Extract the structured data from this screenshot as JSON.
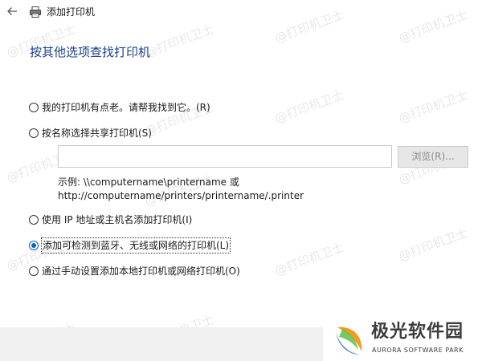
{
  "window": {
    "title": "添加打印机",
    "back_icon": "back-arrow-icon",
    "app_icon": "printer-icon"
  },
  "heading": "按其他选项查找打印机",
  "options": [
    {
      "label": "我的打印机有点老。请帮我找到它。(R)",
      "checked": false
    },
    {
      "label": "按名称选择共享打印机(S)",
      "checked": false
    },
    {
      "label": "使用 IP 地址或主机名添加打印机(I)",
      "checked": false
    },
    {
      "label": "添加可检测到蓝牙、无线或网络的打印机(L)",
      "checked": true
    },
    {
      "label": "通过手动设置添加本地打印机或网络打印机(O)",
      "checked": false
    }
  ],
  "shared_printer": {
    "value": "",
    "browse_label": "浏览(R)..."
  },
  "example": {
    "line1": "示例: \\\\computername\\printername 或",
    "line2": "http://computername/printers/printername/.printer"
  },
  "watermark_text": "@打印机卫士",
  "logo": {
    "name": "极光软件园",
    "subtitle": "AURORA SOFTWARE PARK"
  },
  "colors": {
    "heading": "#1b3f8c",
    "radio_selected": "#0067c0",
    "logo_orange": "#f39a1f",
    "logo_blue": "#2a6fd6",
    "logo_green": "#5cc24a"
  }
}
